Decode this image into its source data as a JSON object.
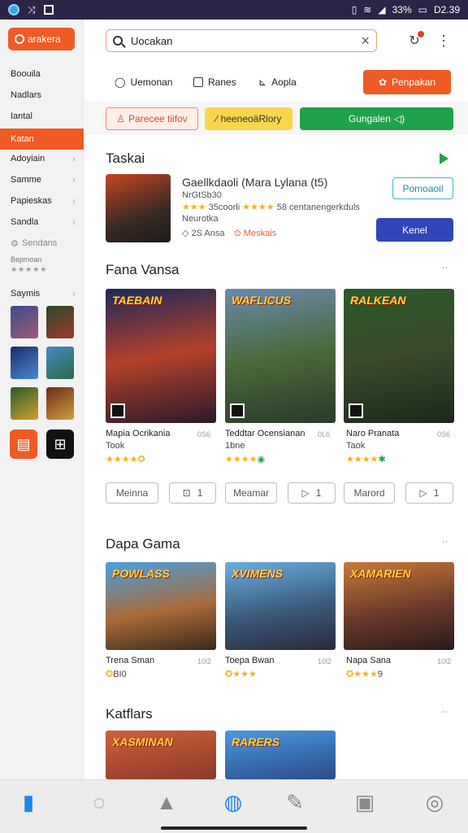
{
  "status_bar": {
    "battery": "33%",
    "time": "D2.39"
  },
  "sidebar": {
    "brand": "arakera",
    "items": [
      {
        "label": "Boouila"
      },
      {
        "label": "Nadlars"
      },
      {
        "label": "Iantal"
      },
      {
        "label": "Katan"
      },
      {
        "label": "Adoyiain"
      },
      {
        "label": "Samme"
      },
      {
        "label": "Papieskas"
      },
      {
        "label": "Sandla"
      },
      {
        "label": "Sendans"
      }
    ],
    "sub_label": "Bepmoan",
    "section_label": "Saymis"
  },
  "search": {
    "value": "Uocakan"
  },
  "tabs": [
    {
      "label": "Uemonan"
    },
    {
      "label": "Ranes"
    },
    {
      "label": "Aopla"
    }
  ],
  "cta": {
    "label": "Penpakan"
  },
  "chips": [
    {
      "label": "Parecee tiifov"
    },
    {
      "label": "heeneoäRlory"
    },
    {
      "label": "Gungalen"
    }
  ],
  "featured": {
    "section_title": "Taskai",
    "title": "Gaellkdaoli (Mara Lylana (t5)",
    "line1": "NrGtSb30",
    "rating_text": "35coorli",
    "count_text": "58 centanengerkduls",
    "dev": "Neurotka",
    "size": "2S Ansa",
    "tag": "Meskais",
    "button_primary": "Pomoaoil",
    "button_secondary": "Kenel"
  },
  "section1": {
    "title": "Fana Vansa",
    "cards": [
      {
        "art_title": "TAEBAIN",
        "name": "Mapia Ocrikania",
        "sub": "Took",
        "meta": "0S6"
      },
      {
        "art_title": "WAFLICUS",
        "name": "Teddtar Ocensianan",
        "sub": "1bne",
        "meta": "0L6"
      },
      {
        "art_title": "RALKEAN",
        "name": "Naro Pranata",
        "sub": "Taok",
        "meta": "0S6"
      }
    ],
    "pills": [
      {
        "label": "Meinna",
        "count": "1"
      },
      {
        "label": "Meamar",
        "count": "1"
      },
      {
        "label": "Marord",
        "count": "1"
      }
    ]
  },
  "section2": {
    "title": "Dapa Gama",
    "cards": [
      {
        "art_title": "POWLASS",
        "name": "Trena Sman",
        "meta": "10l2",
        "rating": "BI0"
      },
      {
        "art_title": "XVIMENS",
        "name": "Toepa Bwan",
        "meta": "10l2",
        "rating": ""
      },
      {
        "art_title": "XAMARIEN",
        "name": "Napa Sana",
        "meta": "10l2",
        "rating": "9"
      }
    ]
  },
  "section3": {
    "title": "Katflars",
    "cards": [
      {
        "art_title": "XASMINAN"
      },
      {
        "art_title": "RARERS"
      }
    ]
  },
  "colors": {
    "accent": "#f05a24",
    "primary_blue": "#2e46b8",
    "green": "#1fa34a",
    "star": "#f2b01e"
  }
}
